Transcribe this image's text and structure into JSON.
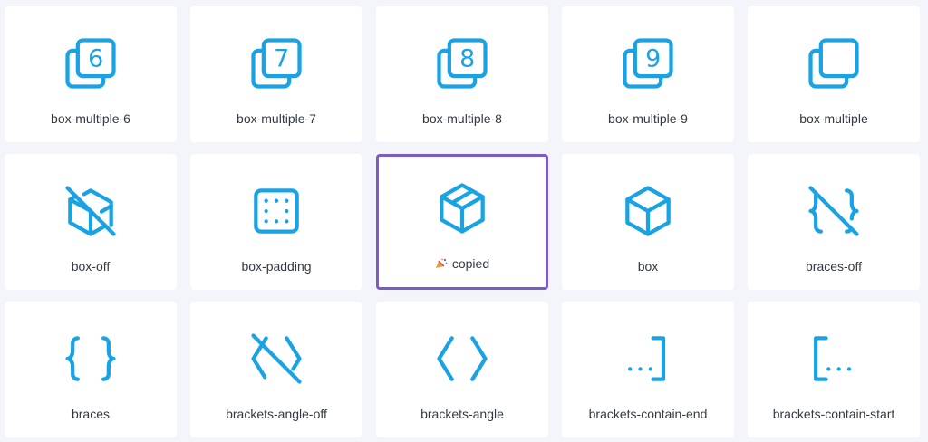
{
  "icons": [
    {
      "label": "box-multiple-6",
      "icon": "box-multiple-6-icon"
    },
    {
      "label": "box-multiple-7",
      "icon": "box-multiple-7-icon"
    },
    {
      "label": "box-multiple-8",
      "icon": "box-multiple-8-icon"
    },
    {
      "label": "box-multiple-9",
      "icon": "box-multiple-9-icon"
    },
    {
      "label": "box-multiple",
      "icon": "box-multiple-icon"
    },
    {
      "label": "box-off",
      "icon": "box-off-icon"
    },
    {
      "label": "box-padding",
      "icon": "box-padding-icon"
    },
    {
      "label": "copied",
      "icon": "box-model-icon",
      "state": "copied",
      "badge_icon": "party-popper-icon"
    },
    {
      "label": "box",
      "icon": "box-icon"
    },
    {
      "label": "braces-off",
      "icon": "braces-off-icon"
    },
    {
      "label": "braces",
      "icon": "braces-icon"
    },
    {
      "label": "brackets-angle-off",
      "icon": "brackets-angle-off-icon"
    },
    {
      "label": "brackets-angle",
      "icon": "brackets-angle-icon"
    },
    {
      "label": "brackets-contain-end",
      "icon": "brackets-contain-end-icon"
    },
    {
      "label": "brackets-contain-start",
      "icon": "brackets-contain-start-icon"
    }
  ],
  "glyphs": {
    "six": "6",
    "seven": "7",
    "eight": "8",
    "nine": "9"
  },
  "colors": {
    "icon_stroke": "#1aa3e4",
    "selected_border": "#7c5cc4",
    "page_background": "#f4f5fb",
    "card_background": "#ffffff"
  }
}
